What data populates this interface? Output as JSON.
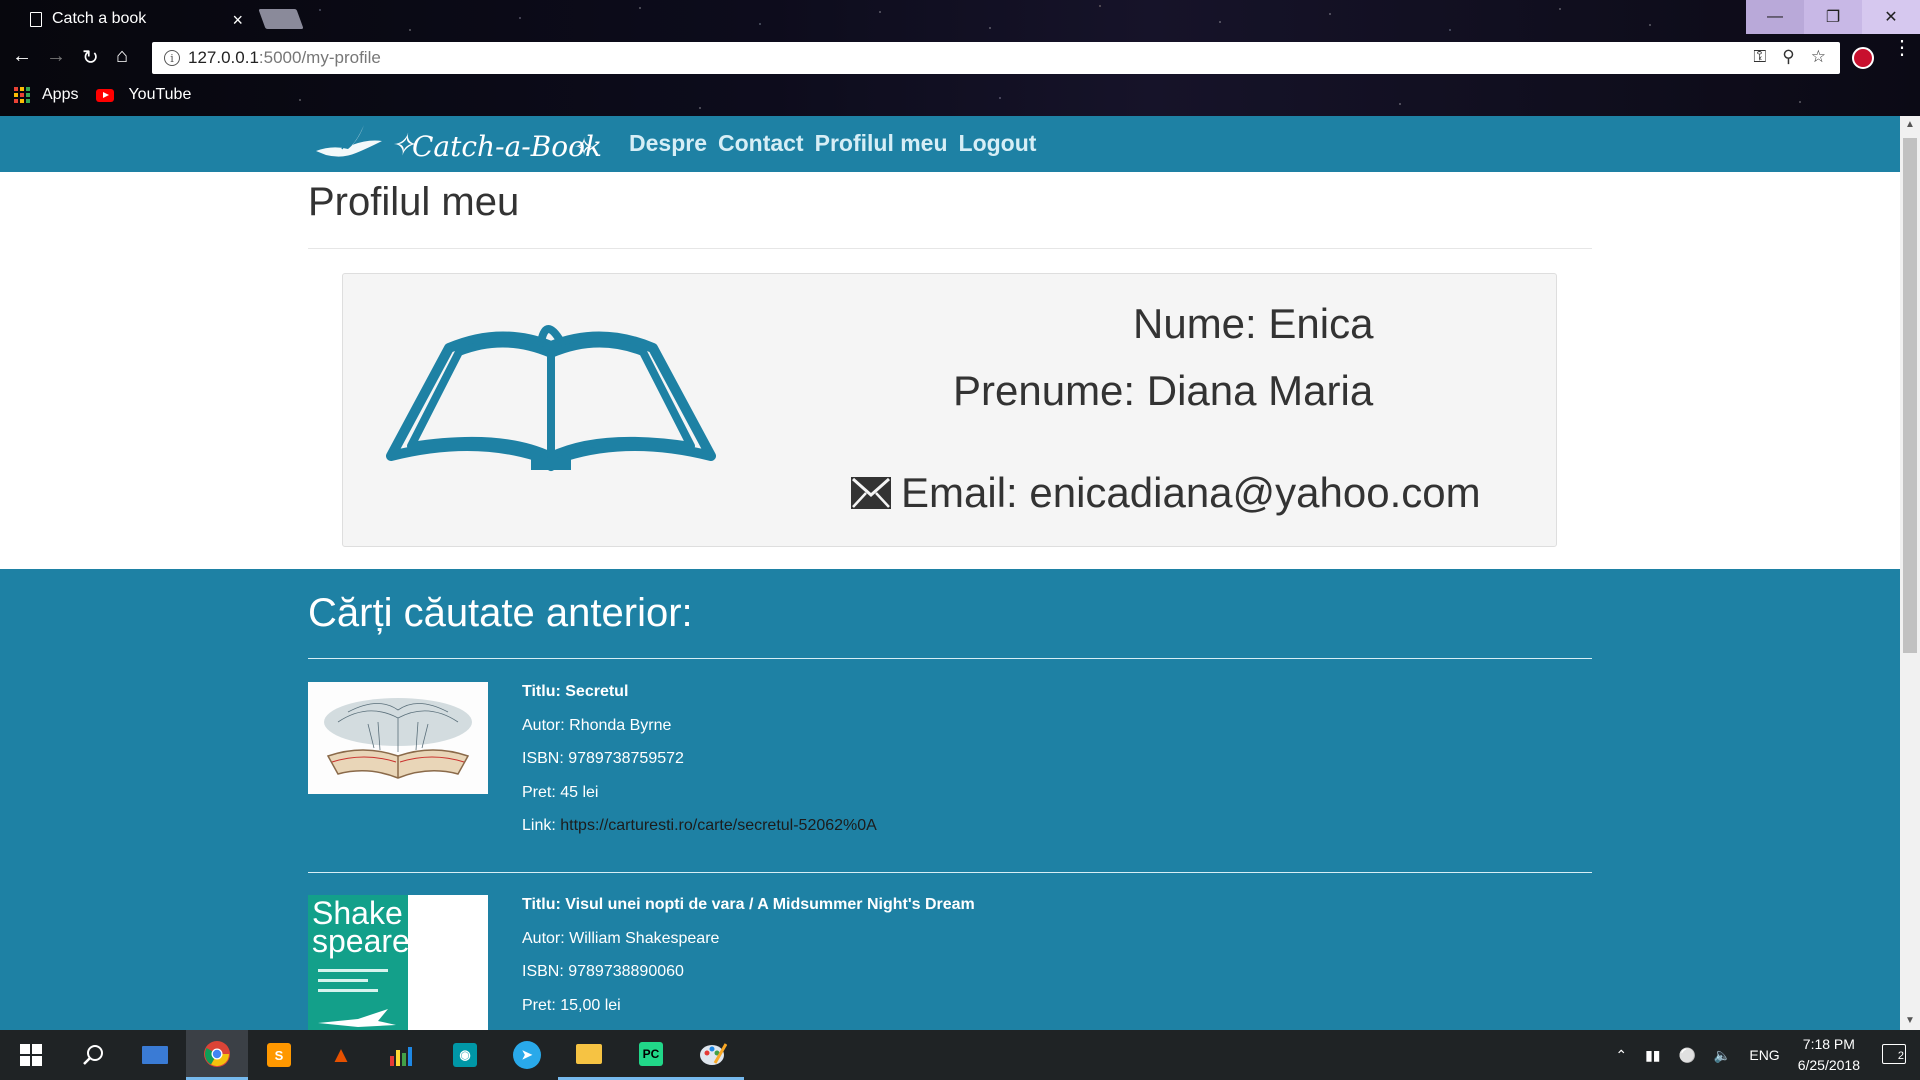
{
  "browser": {
    "tab_title": "Catch a book",
    "tab_close": "×",
    "url_host": "127.0.0.1",
    "url_path": ":5000/my-profile",
    "bookmarks": {
      "apps_label": "Apps",
      "youtube_label": "YouTube"
    },
    "window_controls": {
      "minimize": "—",
      "maximize": "❐",
      "close": "✕"
    }
  },
  "site": {
    "logo_text": "Catch-a-Book",
    "nav": {
      "about": "Despre",
      "contact": "Contact",
      "profile": "Profilul meu",
      "logout": "Logout"
    },
    "page_title": "Profilul meu",
    "profile": {
      "nume": "Nume: Enica",
      "prenume": "Prenume: Diana Maria",
      "email": "Email: enicadiana@yahoo.com"
    },
    "history": {
      "title": "Cărți căutate anterior:",
      "books": [
        {
          "title": "Titlu: Secretul",
          "author": "Autor: Rhonda Byrne",
          "isbn": "ISBN: 9789738759572",
          "price": "Pret: 45 lei",
          "link_label": "Link: ",
          "link_url": "https://carturesti.ro/carte/secretul-52062%0A"
        },
        {
          "title": "Titlu: Visul unei nopti de vara / A Midsummer Night's Dream",
          "author": "Autor: William Shakespeare",
          "isbn": "ISBN: 9789738890060",
          "price": "Pret: 15,00 lei",
          "cover_text_1": "Shake",
          "cover_text_2": "speare"
        }
      ]
    }
  },
  "taskbar": {
    "language": "ENG",
    "time": "7:18 PM",
    "date": "6/25/2018",
    "notification_count": "2"
  },
  "colors": {
    "brand_teal": "#1e81a4",
    "nav_link": "#d6eef6",
    "card_bg": "#f5f5f5"
  }
}
